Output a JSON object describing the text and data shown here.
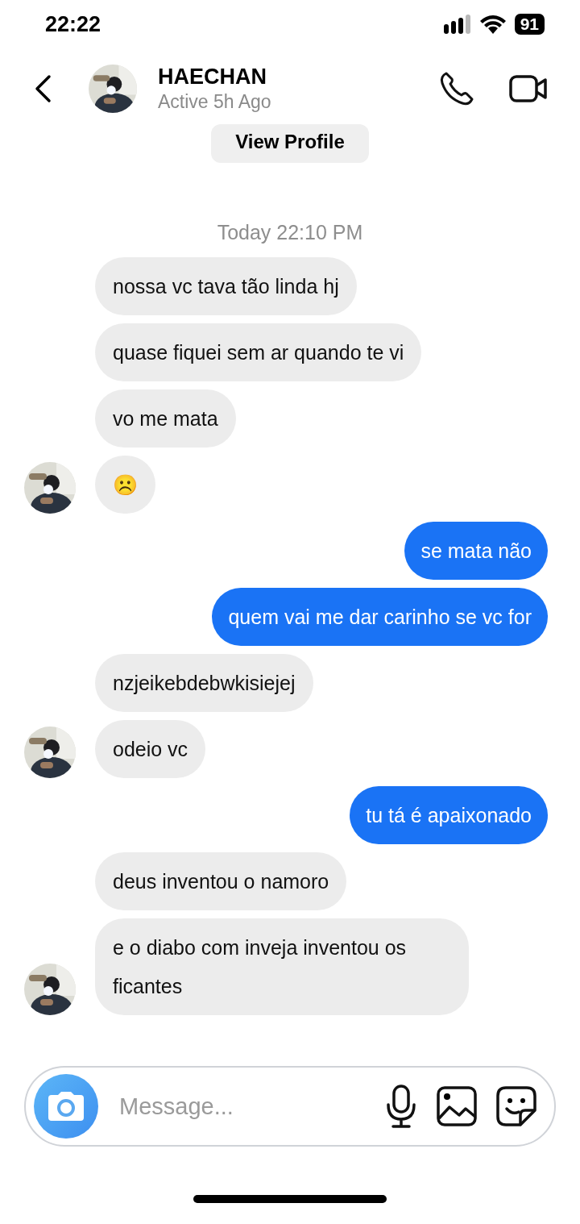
{
  "status_bar": {
    "time": "22:22",
    "battery": "91"
  },
  "header": {
    "name": "HAECHAN",
    "status": "Active 5h Ago"
  },
  "profile_button": "View Profile",
  "timestamp": "Today 22:10 PM",
  "messages": [
    {
      "kind": "incoming",
      "text": "nossa vc tava tão linda hj",
      "avatar": false
    },
    {
      "kind": "incoming",
      "text": "quase fiquei sem ar quando te vi",
      "avatar": false
    },
    {
      "kind": "incoming",
      "text": "vo me mata",
      "avatar": false
    },
    {
      "kind": "incoming",
      "text": "☹️",
      "avatar": true
    },
    {
      "kind": "outgoing",
      "text": "se mata não"
    },
    {
      "kind": "outgoing",
      "text": "quem vai me dar carinho se vc for"
    },
    {
      "kind": "incoming",
      "text": "nzjeikebdebwkisiejej",
      "avatar": false
    },
    {
      "kind": "incoming",
      "text": "odeio vc",
      "avatar": true
    },
    {
      "kind": "outgoing",
      "text": "tu tá é apaixonado"
    },
    {
      "kind": "incoming",
      "text": "deus inventou o namoro",
      "avatar": false
    },
    {
      "kind": "incoming",
      "text": "e o diabo com inveja inventou os ficantes",
      "avatar": true
    }
  ],
  "composer": {
    "placeholder": "Message..."
  }
}
